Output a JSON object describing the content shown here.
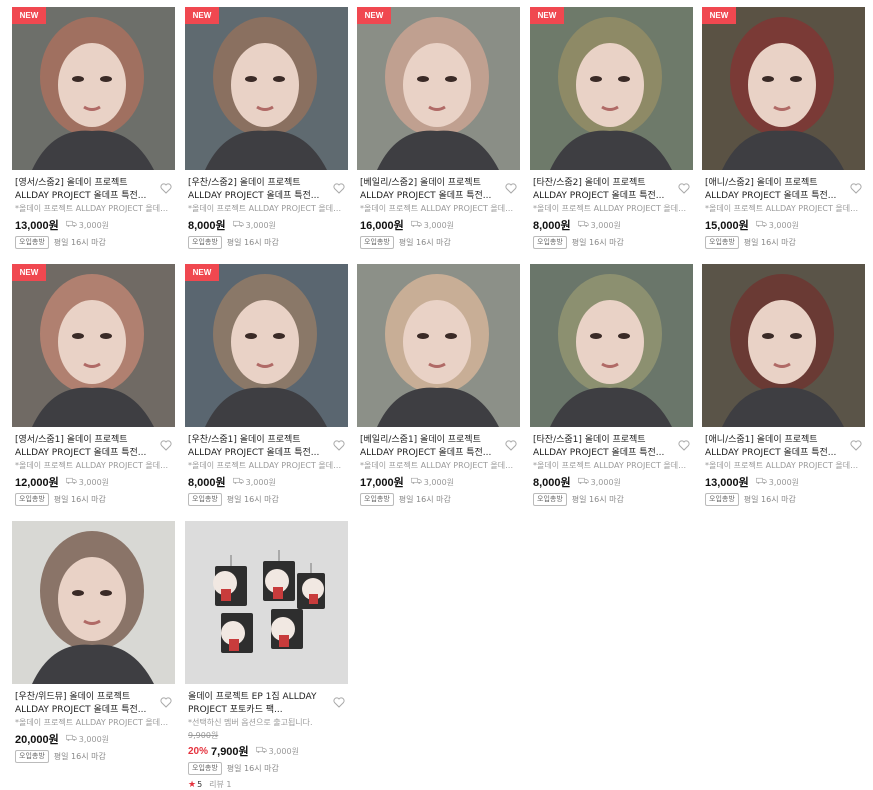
{
  "badge_new": "NEW",
  "products": [
    {
      "title": "[영서/스줌2] 올데이 프로젝트 ALLDAY PROJECT 올데프 특전...",
      "desc": "*올데이 프로젝트 ALLDAY PROJECT 올데프 특전",
      "price": "13,000원",
      "shipping": "3,000원",
      "tag": "오입총방",
      "deadline": "평일 16시 마감",
      "is_new": true,
      "tone": "#a07060",
      "bg": "#6d6f6a"
    },
    {
      "title": "[우찬/스줌2] 올데이 프로젝트 ALLDAY PROJECT 올데프 특전...",
      "desc": "*올데이 프로젝트 ALLDAY PROJECT 올데프 특전",
      "price": "8,000원",
      "shipping": "3,000원",
      "tag": "오입총방",
      "deadline": "평일 16시 마감",
      "is_new": true,
      "tone": "#8a7060",
      "bg": "#5f6a70"
    },
    {
      "title": "[베일리/스줌2] 올데이 프로젝트 ALLDAY PROJECT 올데프 특전...",
      "desc": "*올데이 프로젝트 ALLDAY PROJECT 올데프 특전",
      "price": "16,000원",
      "shipping": "3,000원",
      "tag": "오입총방",
      "deadline": "평일 16시 마감",
      "is_new": true,
      "tone": "#c0a090",
      "bg": "#8a8e86"
    },
    {
      "title": "[타잔/스줌2] 올데이 프로젝트 ALLDAY PROJECT 올데프 특전...",
      "desc": "*올데이 프로젝트 ALLDAY PROJECT 올데프 특전",
      "price": "8,000원",
      "shipping": "3,000원",
      "tag": "오입총방",
      "deadline": "평일 16시 마감",
      "is_new": true,
      "tone": "#8e8a66",
      "bg": "#6e7a6a"
    },
    {
      "title": "[애니/스줌2] 올데이 프로젝트 ALLDAY PROJECT 올데프 특전...",
      "desc": "*올데이 프로젝트 ALLDAY PROJECT 올데프 특전",
      "price": "15,000원",
      "shipping": "3,000원",
      "tag": "오입총방",
      "deadline": "평일 16시 마감",
      "is_new": true,
      "tone": "#7a3a36",
      "bg": "#5a5244"
    },
    {
      "title": "[영서/스줌1] 올데이 프로젝트 ALLDAY PROJECT 올데프 특전...",
      "desc": "*올데이 프로젝트 ALLDAY PROJECT 올데프 특전",
      "price": "12,000원",
      "shipping": "3,000원",
      "tag": "오입총방",
      "deadline": "평일 16시 마감",
      "is_new": true,
      "tone": "#b08070",
      "bg": "#706a64"
    },
    {
      "title": "[우찬/스줌1] 올데이 프로젝트 ALLDAY PROJECT 올데프 특전...",
      "desc": "*올데이 프로젝트 ALLDAY PROJECT 올데프 특전",
      "price": "8,000원",
      "shipping": "3,000원",
      "tag": "오입총방",
      "deadline": "평일 16시 마감",
      "is_new": true,
      "tone": "#8a7868",
      "bg": "#5a6670"
    },
    {
      "title": "[베일리/스줌1] 올데이 프로젝트 ALLDAY PROJECT 올데프 특전...",
      "desc": "*올데이 프로젝트 ALLDAY PROJECT 올데프 특전",
      "price": "17,000원",
      "shipping": "3,000원",
      "tag": "오입총방",
      "deadline": "평일 16시 마감",
      "is_new": false,
      "tone": "#c8ae96",
      "bg": "#8c9088"
    },
    {
      "title": "[타잔/스줌1] 올데이 프로젝트 ALLDAY PROJECT 올데프 특전...",
      "desc": "*올데이 프로젝트 ALLDAY PROJECT 올데프 특전",
      "price": "8,000원",
      "shipping": "3,000원",
      "tag": "오입총방",
      "deadline": "평일 16시 마감",
      "is_new": false,
      "tone": "#8c9070",
      "bg": "#6a766a"
    },
    {
      "title": "[애니/스줌1] 올데이 프로젝트 ALLDAY PROJECT 올데프 특전...",
      "desc": "*올데이 프로젝트 ALLDAY PROJECT 올데프 특전",
      "price": "13,000원",
      "shipping": "3,000원",
      "tag": "오입총방",
      "deadline": "평일 16시 마감",
      "is_new": false,
      "tone": "#6a3a34",
      "bg": "#5a5448"
    },
    {
      "title": "[우찬/위드뮤] 올데이 프로젝트 ALLDAY PROJECT 올데프 특전...",
      "desc": "*올데이 프로젝트 ALLDAY PROJECT 올데프 특전",
      "price": "20,000원",
      "shipping": "3,000원",
      "tag": "오입총방",
      "deadline": "평일 16시 마감",
      "is_new": false,
      "tone": "#8a7468",
      "bg": "#d8d8d4"
    },
    {
      "title": "올데이 프로젝트 EP 1집 ALLDAY PROJECT 포토카드 팩...",
      "desc": "*선택하신 멤버 옵션으로 출고됩니다.",
      "original_price": "9,900원",
      "discount": "20%",
      "price": "7,900원",
      "shipping": "3,000원",
      "tag": "오입총방",
      "deadline": "평일 16시 마감",
      "rating": "5",
      "review": "리뷰 1",
      "is_new": false,
      "tone": "#303030",
      "bg": "#dcdcdc"
    }
  ],
  "icons": {
    "heart": "heart-outline-icon",
    "truck": "truck-icon",
    "star": "star-icon"
  },
  "colors": {
    "badge": "#f04850",
    "discount": "#e5333e"
  }
}
